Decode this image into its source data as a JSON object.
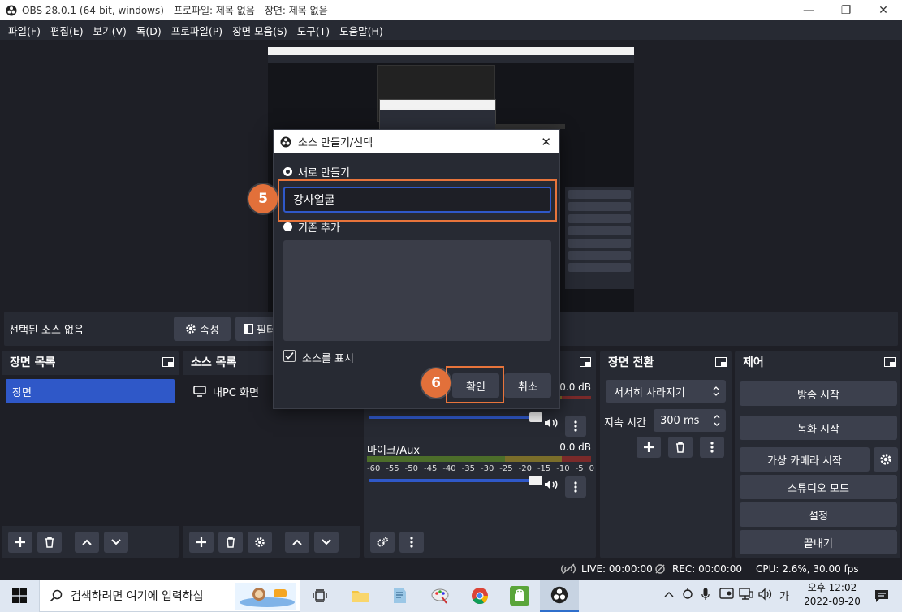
{
  "window": {
    "title": "OBS 28.0.1 (64-bit, windows) - 프로파일: 제목 없음 - 장면: 제목 없음",
    "minimize": "—",
    "maximize": "❐",
    "close": "✕"
  },
  "menu": [
    "파일(F)",
    "편집(E)",
    "보기(V)",
    "독(D)",
    "프로파일(P)",
    "장면 모음(S)",
    "도구(T)",
    "도움말(H)"
  ],
  "source_toolbar": {
    "no_source": "선택된 소스 없음",
    "properties": "속성",
    "filters": "필터"
  },
  "scenes": {
    "title": "장면 목록",
    "items": [
      "장면"
    ]
  },
  "sources": {
    "title": "소스 목록",
    "items": [
      "내PC 화면"
    ]
  },
  "mixer": {
    "channels": [
      {
        "name": "",
        "db": "0.0 dB"
      },
      {
        "name": "마이크/Aux",
        "db": "0.0 dB"
      }
    ],
    "ticks": [
      "-60",
      "-55",
      "-50",
      "-45",
      "-40",
      "-35",
      "-30",
      "-25",
      "-20",
      "-15",
      "-10",
      "-5",
      "0"
    ]
  },
  "transitions": {
    "title": "장면 전환",
    "selected": "서서히 사라지기",
    "duration_label": "지속 시간",
    "duration_value": "300 ms"
  },
  "controls": {
    "title": "제어",
    "buttons": [
      "방송 시작",
      "녹화 시작",
      "가상 카메라 시작",
      "스튜디오 모드",
      "설정",
      "끝내기"
    ]
  },
  "statusbar": {
    "live": "LIVE: 00:00:00",
    "rec": "REC: 00:00:00",
    "cpu": "CPU: 2.6%, 30.00 fps"
  },
  "dialog": {
    "title": "소스 만들기/선택",
    "create_new": "새로 만들기",
    "name_value": "강사얼굴",
    "add_existing": "기존 추가",
    "make_visible": "소스를 표시",
    "ok": "확인",
    "cancel": "취소"
  },
  "annotations": {
    "step5": "5",
    "step6": "6"
  },
  "taskbar": {
    "search_placeholder": "검색하려면 여기에 입력하십",
    "time": "오후 12:02",
    "date": "2022-09-20",
    "ime": "가"
  },
  "colors": {
    "accent": "#2f58c8",
    "highlight": "#e8743b",
    "panel": "#272a33",
    "background": "#1e1f26"
  }
}
